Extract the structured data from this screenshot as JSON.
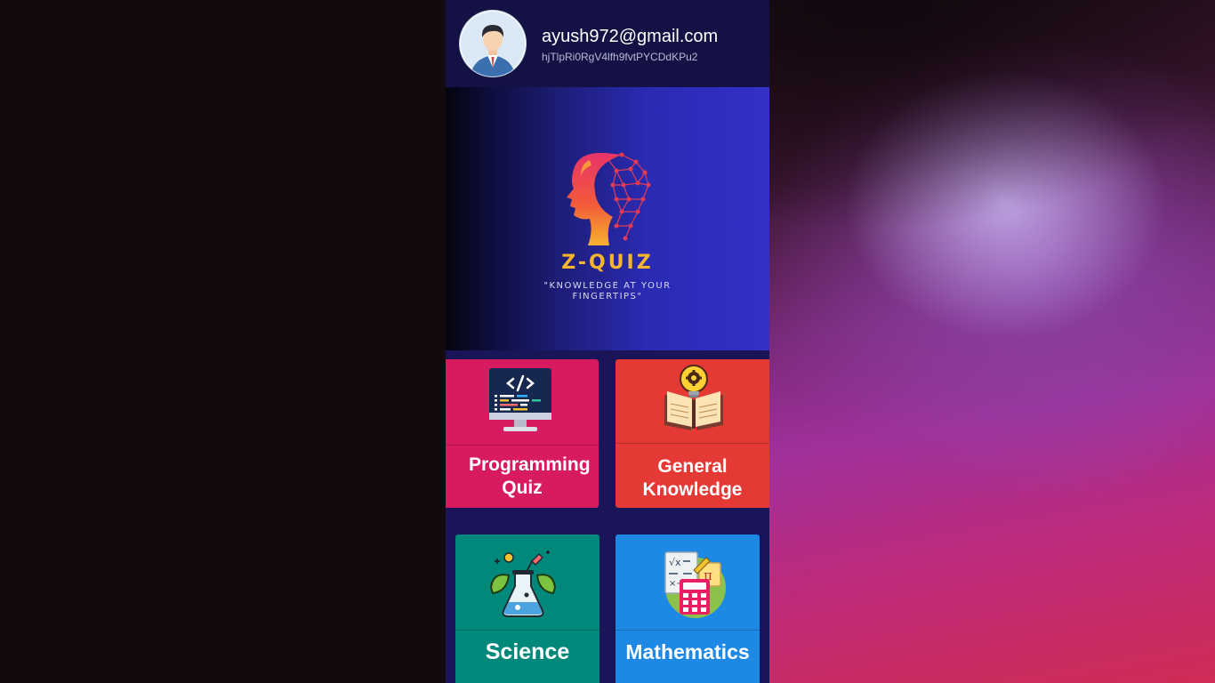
{
  "user": {
    "email": "ayush972@gmail.com",
    "uid": "hjTlpRi0RgV4lfh9fvtPYCDdKPu2"
  },
  "banner": {
    "brand": "Z-QUIZ",
    "tagline": "\"KNOWLEDGE AT YOUR FINGERTIPS\""
  },
  "categories": [
    {
      "label": "Programming Quiz",
      "color": "#d81b60",
      "icon": "computer-code-icon"
    },
    {
      "label": "General Knowledge",
      "color": "#e53935",
      "icon": "lightbulb-book-icon"
    },
    {
      "label": "Science",
      "color": "#00897b",
      "icon": "flask-leaf-icon"
    },
    {
      "label": "Mathematics",
      "color": "#1e88e5",
      "icon": "calculator-math-icon"
    }
  ],
  "colors": {
    "header_bg": "#141244",
    "app_bg": "#1a1458",
    "brand_accent": "#f5b52e"
  }
}
